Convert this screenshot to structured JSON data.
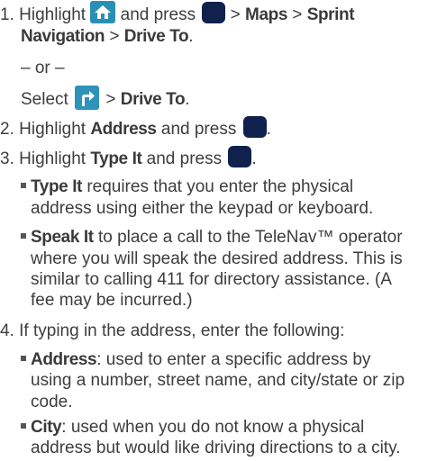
{
  "step1": {
    "number": "1.",
    "highlight": "Highlight",
    "and_press": "and press",
    "sep": ">",
    "maps": "Maps",
    "sprint_navigation": "Sprint Navigation",
    "drive_to": "Drive To",
    "period": ".",
    "or": "– or –",
    "select": "Select",
    "drive_to_2": "Drive To"
  },
  "step2": {
    "number": "2.",
    "highlight": "Highlight",
    "address": "Address",
    "and_press": "and press"
  },
  "step3": {
    "number": "3.",
    "highlight": "Highlight",
    "type_it": "Type It",
    "and_press": "and press",
    "bullet1_term": "Type It",
    "bullet1_line1": "requires that you enter the physical",
    "bullet1_line2": "address using either the keypad or keyboard.",
    "bullet2_term": "Speak It",
    "bullet2_line1": "to place a call to the TeleNav™ operator",
    "bullet2_line2": "where you will speak the desired address. This is",
    "bullet2_line3": "similar to calling 411 for directory assistance. (A",
    "bullet2_line4": "fee may be incurred.)"
  },
  "step4": {
    "number": "4.",
    "intro": "If typing in the address, enter the following:",
    "bullet1_term": "Address",
    "bullet1_line1": ": used to enter a specific address by",
    "bullet1_line2": "using a number, street name, and city/state or zip",
    "bullet1_line3": "code.",
    "bullet2_term": "City",
    "bullet2_line1": ": used when you do not know a physical",
    "bullet2_line2": "address but would like driving directions to a city."
  },
  "icons": {
    "home": "home-icon",
    "ok": "ok-key-icon",
    "navigation": "navigation-turn-icon"
  },
  "colors": {
    "home_icon_bg": "#2a8fb5",
    "ok_key": "#10214e",
    "text": "#3d3d3d"
  }
}
